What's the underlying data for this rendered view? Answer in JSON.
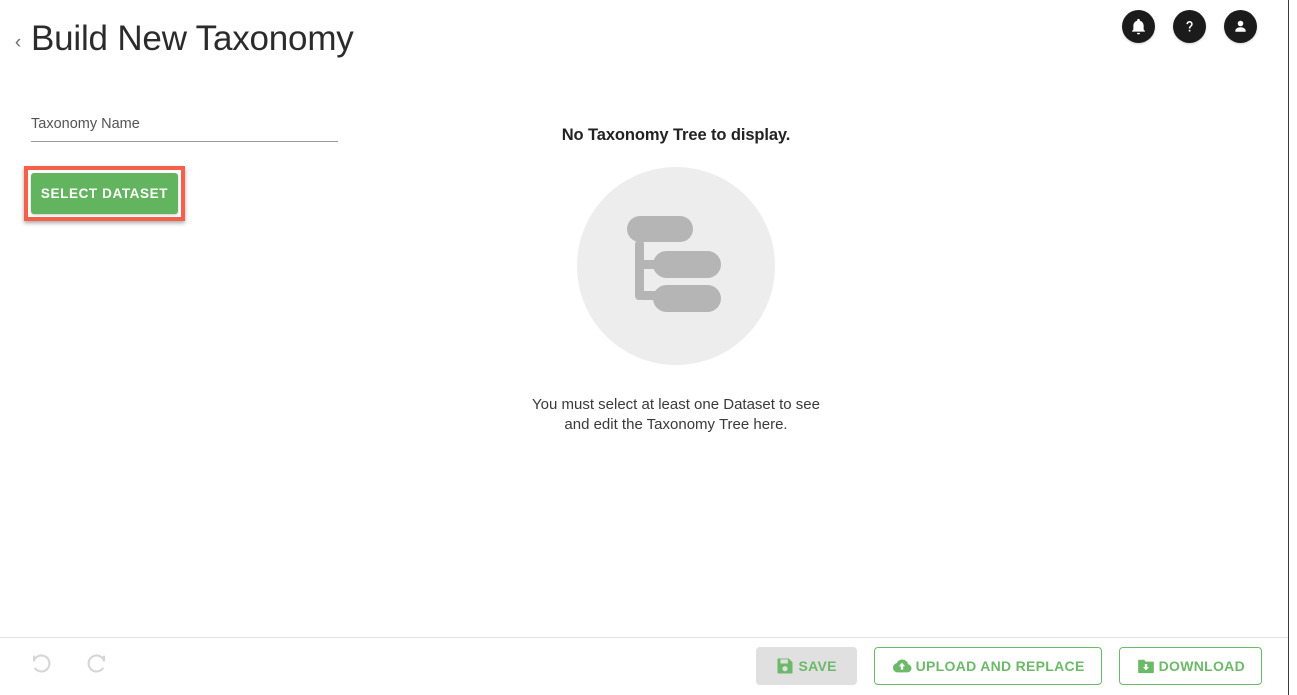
{
  "header": {
    "back_label": "‹",
    "title": "Build New Taxonomy",
    "icons": [
      {
        "name": "notification-bell-icon",
        "label": "Notifications"
      },
      {
        "name": "help-question-icon",
        "label": "Help"
      },
      {
        "name": "account-person-icon",
        "label": "Account"
      }
    ]
  },
  "form": {
    "taxonomy_name_placeholder": "Taxonomy Name",
    "taxonomy_name_value": "",
    "select_dataset_label": "SELECT DATASET",
    "highlight_color": "#f4604a",
    "primary_color": "#62b45e"
  },
  "empty_state": {
    "title": "No Taxonomy Tree to display.",
    "illustration": "taxonomy-tree-icon",
    "message_line_1": "You must select at least one Dataset to see",
    "message_line_2": "and edit the Taxonomy Tree here."
  },
  "footer": {
    "undo_label": "Undo",
    "redo_label": "Redo",
    "save_label": "SAVE",
    "upload_label": "UPLOAD AND REPLACE",
    "download_label": "DOWNLOAD",
    "accent_color": "#6cb96a",
    "save_disabled_background": "#e0e0e0"
  }
}
